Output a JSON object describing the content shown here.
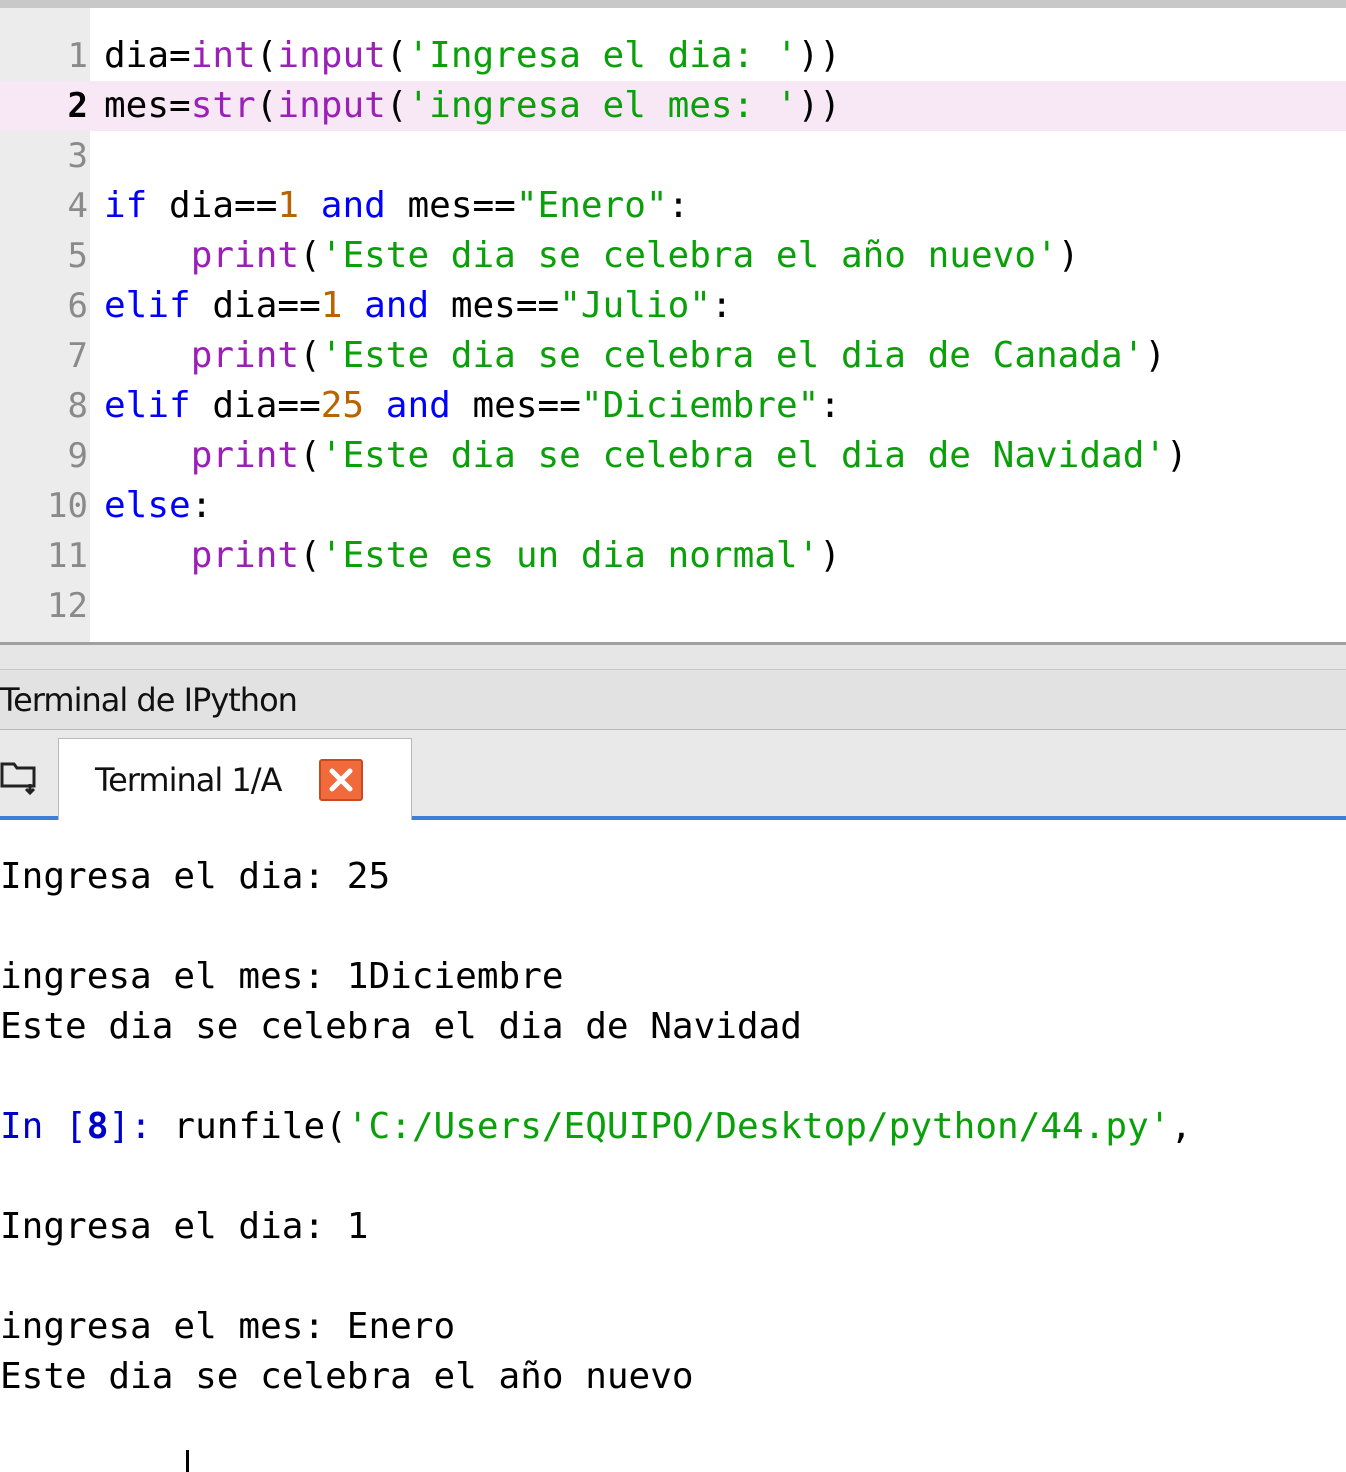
{
  "editor": {
    "current_line": 2,
    "lines": [
      {
        "n": "1",
        "tokens": [
          [
            "pn",
            "dia="
          ],
          [
            "bi",
            "int"
          ],
          [
            "pn",
            "("
          ],
          [
            "bi",
            "input"
          ],
          [
            "pn",
            "("
          ],
          [
            "st",
            "'Ingresa el dia: '"
          ],
          [
            "pn",
            "))"
          ]
        ]
      },
      {
        "n": "2",
        "tokens": [
          [
            "pn",
            "mes="
          ],
          [
            "bi",
            "str"
          ],
          [
            "pn",
            "("
          ],
          [
            "bi",
            "input"
          ],
          [
            "pn",
            "("
          ],
          [
            "st",
            "'ingresa el mes: '"
          ],
          [
            "pn",
            "))"
          ]
        ]
      },
      {
        "n": "3",
        "tokens": []
      },
      {
        "n": "4",
        "tokens": [
          [
            "kw",
            "if"
          ],
          [
            "pn",
            " dia=="
          ],
          [
            "nm",
            "1"
          ],
          [
            "pn",
            " "
          ],
          [
            "kw",
            "and"
          ],
          [
            "pn",
            " mes=="
          ],
          [
            "st",
            "\"Enero\""
          ],
          [
            "pn",
            ":"
          ]
        ]
      },
      {
        "n": "5",
        "tokens": [
          [
            "pn",
            "    "
          ],
          [
            "bi",
            "print"
          ],
          [
            "pn",
            "("
          ],
          [
            "st",
            "'Este dia se celebra el año nuevo'"
          ],
          [
            "pn",
            ")"
          ]
        ]
      },
      {
        "n": "6",
        "tokens": [
          [
            "kw",
            "elif"
          ],
          [
            "pn",
            " dia=="
          ],
          [
            "nm",
            "1"
          ],
          [
            "pn",
            " "
          ],
          [
            "kw",
            "and"
          ],
          [
            "pn",
            " mes=="
          ],
          [
            "st",
            "\"Julio\""
          ],
          [
            "pn",
            ":"
          ]
        ]
      },
      {
        "n": "7",
        "tokens": [
          [
            "pn",
            "    "
          ],
          [
            "bi",
            "print"
          ],
          [
            "pn",
            "("
          ],
          [
            "st",
            "'Este dia se celebra el dia de Canada'"
          ],
          [
            "pn",
            ")"
          ]
        ]
      },
      {
        "n": "8",
        "tokens": [
          [
            "kw",
            "elif"
          ],
          [
            "pn",
            " dia=="
          ],
          [
            "nm",
            "25"
          ],
          [
            "pn",
            " "
          ],
          [
            "kw",
            "and"
          ],
          [
            "pn",
            " mes=="
          ],
          [
            "st",
            "\"Diciembre\""
          ],
          [
            "pn",
            ":"
          ]
        ]
      },
      {
        "n": "9",
        "tokens": [
          [
            "pn",
            "    "
          ],
          [
            "bi",
            "print"
          ],
          [
            "pn",
            "("
          ],
          [
            "st",
            "'Este dia se celebra el dia de Navidad'"
          ],
          [
            "pn",
            ")"
          ]
        ]
      },
      {
        "n": "10",
        "tokens": [
          [
            "kw",
            "else"
          ],
          [
            "pn",
            ":"
          ]
        ]
      },
      {
        "n": "11",
        "tokens": [
          [
            "pn",
            "    "
          ],
          [
            "bi",
            "print"
          ],
          [
            "pn",
            "("
          ],
          [
            "st",
            "'Este es un dia normal'"
          ],
          [
            "pn",
            ")"
          ]
        ]
      },
      {
        "n": "12",
        "tokens": []
      }
    ]
  },
  "pane": {
    "title": "Terminal de IPython",
    "tab_label": "Terminal 1/A",
    "tab_icon": "folder-icon",
    "close_icon": "close-icon",
    "accent": "#3c7fd4",
    "close_color": "#f06a3c"
  },
  "terminal": {
    "lines": [
      {
        "row": 0,
        "tokens": [
          [
            "out",
            "Ingresa el dia: 25"
          ]
        ]
      },
      {
        "row": 2,
        "tokens": [
          [
            "out",
            "ingresa el mes: 1Diciembre"
          ]
        ]
      },
      {
        "row": 3,
        "tokens": [
          [
            "out",
            "Este dia se celebra el dia de Navidad"
          ]
        ]
      },
      {
        "row": 5,
        "tokens": [
          [
            "prompt",
            "In ["
          ],
          [
            "prompt-num",
            "8"
          ],
          [
            "prompt",
            "]: "
          ],
          [
            "out",
            "runfile("
          ],
          [
            "tstr",
            "'C:/Users/EQUIPO/Desktop/python/44.py'"
          ],
          [
            "out",
            ","
          ]
        ]
      },
      {
        "row": 7,
        "tokens": [
          [
            "out",
            "Ingresa el dia: 1"
          ]
        ]
      },
      {
        "row": 9,
        "tokens": [
          [
            "out",
            "ingresa el mes: Enero"
          ]
        ]
      },
      {
        "row": 10,
        "tokens": [
          [
            "out",
            "Este dia se celebra el año nuevo"
          ]
        ]
      }
    ]
  }
}
